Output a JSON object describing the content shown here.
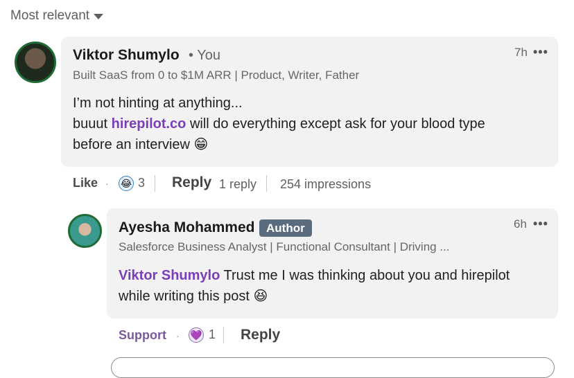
{
  "sort": {
    "label": "Most relevant"
  },
  "comment": {
    "author": "Viktor Shumylo",
    "you": "• You",
    "subtitle": "Built SaaS from 0 to $1M ARR | Product, Writer, Father",
    "time": "7h",
    "more": "•••",
    "body_line1": "I’m not hinting at anything...",
    "body_line2_pre": "buuut ",
    "body_link": "hirepilot.co",
    "body_line2_post": " will do everything except ask for your blood type",
    "body_line3": "before an interview",
    "body_emoji": "😁",
    "actions": {
      "like": "Like",
      "reaction_count": "3",
      "reply": "Reply",
      "reply_count": "1 reply",
      "impressions": "254 impressions"
    }
  },
  "reply": {
    "author": "Ayesha Mohammed",
    "badge": "Author",
    "subtitle": "Salesforce Business Analyst | Functional Consultant | Driving ...",
    "time": "6h",
    "more": "•••",
    "mention": "Viktor Shumylo",
    "body_line1_post": " Trust me I was thinking about you and hirepilot",
    "body_line2": "while writing this post",
    "body_emoji": "😆",
    "actions": {
      "support": "Support",
      "reaction_count": "1",
      "reply": "Reply"
    }
  },
  "icons": [
    "caret-down-icon",
    "more-icon",
    "reaction-funny-icon",
    "reaction-support-icon"
  ]
}
